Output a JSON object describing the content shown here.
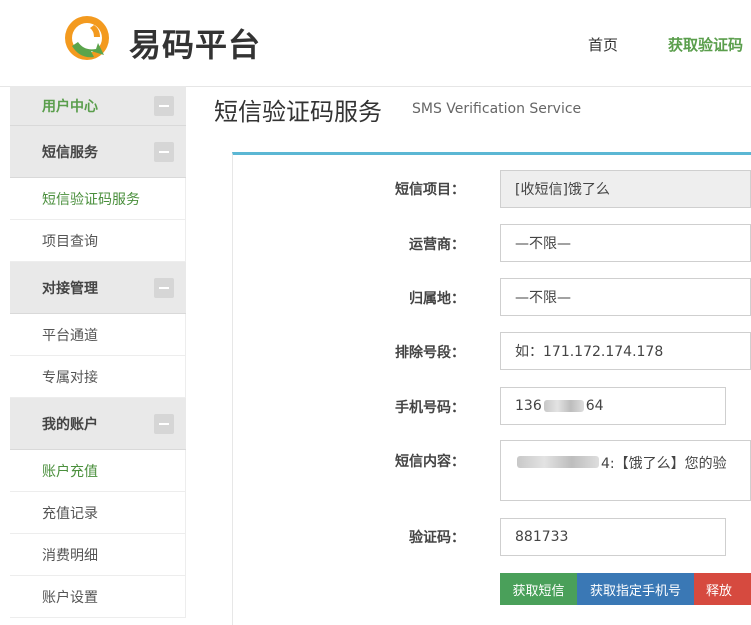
{
  "header": {
    "brand": "易码平台",
    "nav_home": "首页",
    "nav_active": "获取验证码"
  },
  "sidebar": {
    "groups": [
      {
        "label": "用户中心",
        "items": []
      },
      {
        "label": "短信服务",
        "items": [
          "短信验证码服务",
          "项目查询"
        ]
      },
      {
        "label": "对接管理",
        "items": [
          "平台通道",
          "专属对接"
        ]
      },
      {
        "label": "我的账户",
        "items": [
          "账户充值",
          "充值记录",
          "消费明细",
          "账户设置"
        ]
      }
    ]
  },
  "main": {
    "title": "短信验证码服务",
    "subtitle": "SMS Verification Service",
    "form": {
      "project_label": "短信项目：",
      "project_value": "[收短信]饿了么",
      "carrier_label": "运营商：",
      "carrier_value": "—不限—",
      "region_label": "归属地：",
      "region_value": "—不限—",
      "exclude_label": "排除号段：",
      "exclude_placeholder": "如：171.172.174.178",
      "phone_label": "手机号码：",
      "phone_prefix": "136",
      "phone_suffix": "64",
      "content_label": "短信内容：",
      "content_suffix": "4:【饿了么】您的验",
      "code_label": "验证码：",
      "code_value": "881733"
    },
    "buttons": {
      "get_sms": "获取短信",
      "get_specific": "获取指定手机号",
      "release": "释放"
    }
  },
  "colors": {
    "accent_green": "#5a9e4c",
    "panel_top": "#5bb7d4",
    "btn_green": "#4aa05a",
    "btn_blue": "#3a78b5",
    "btn_red": "#d64a3f"
  }
}
